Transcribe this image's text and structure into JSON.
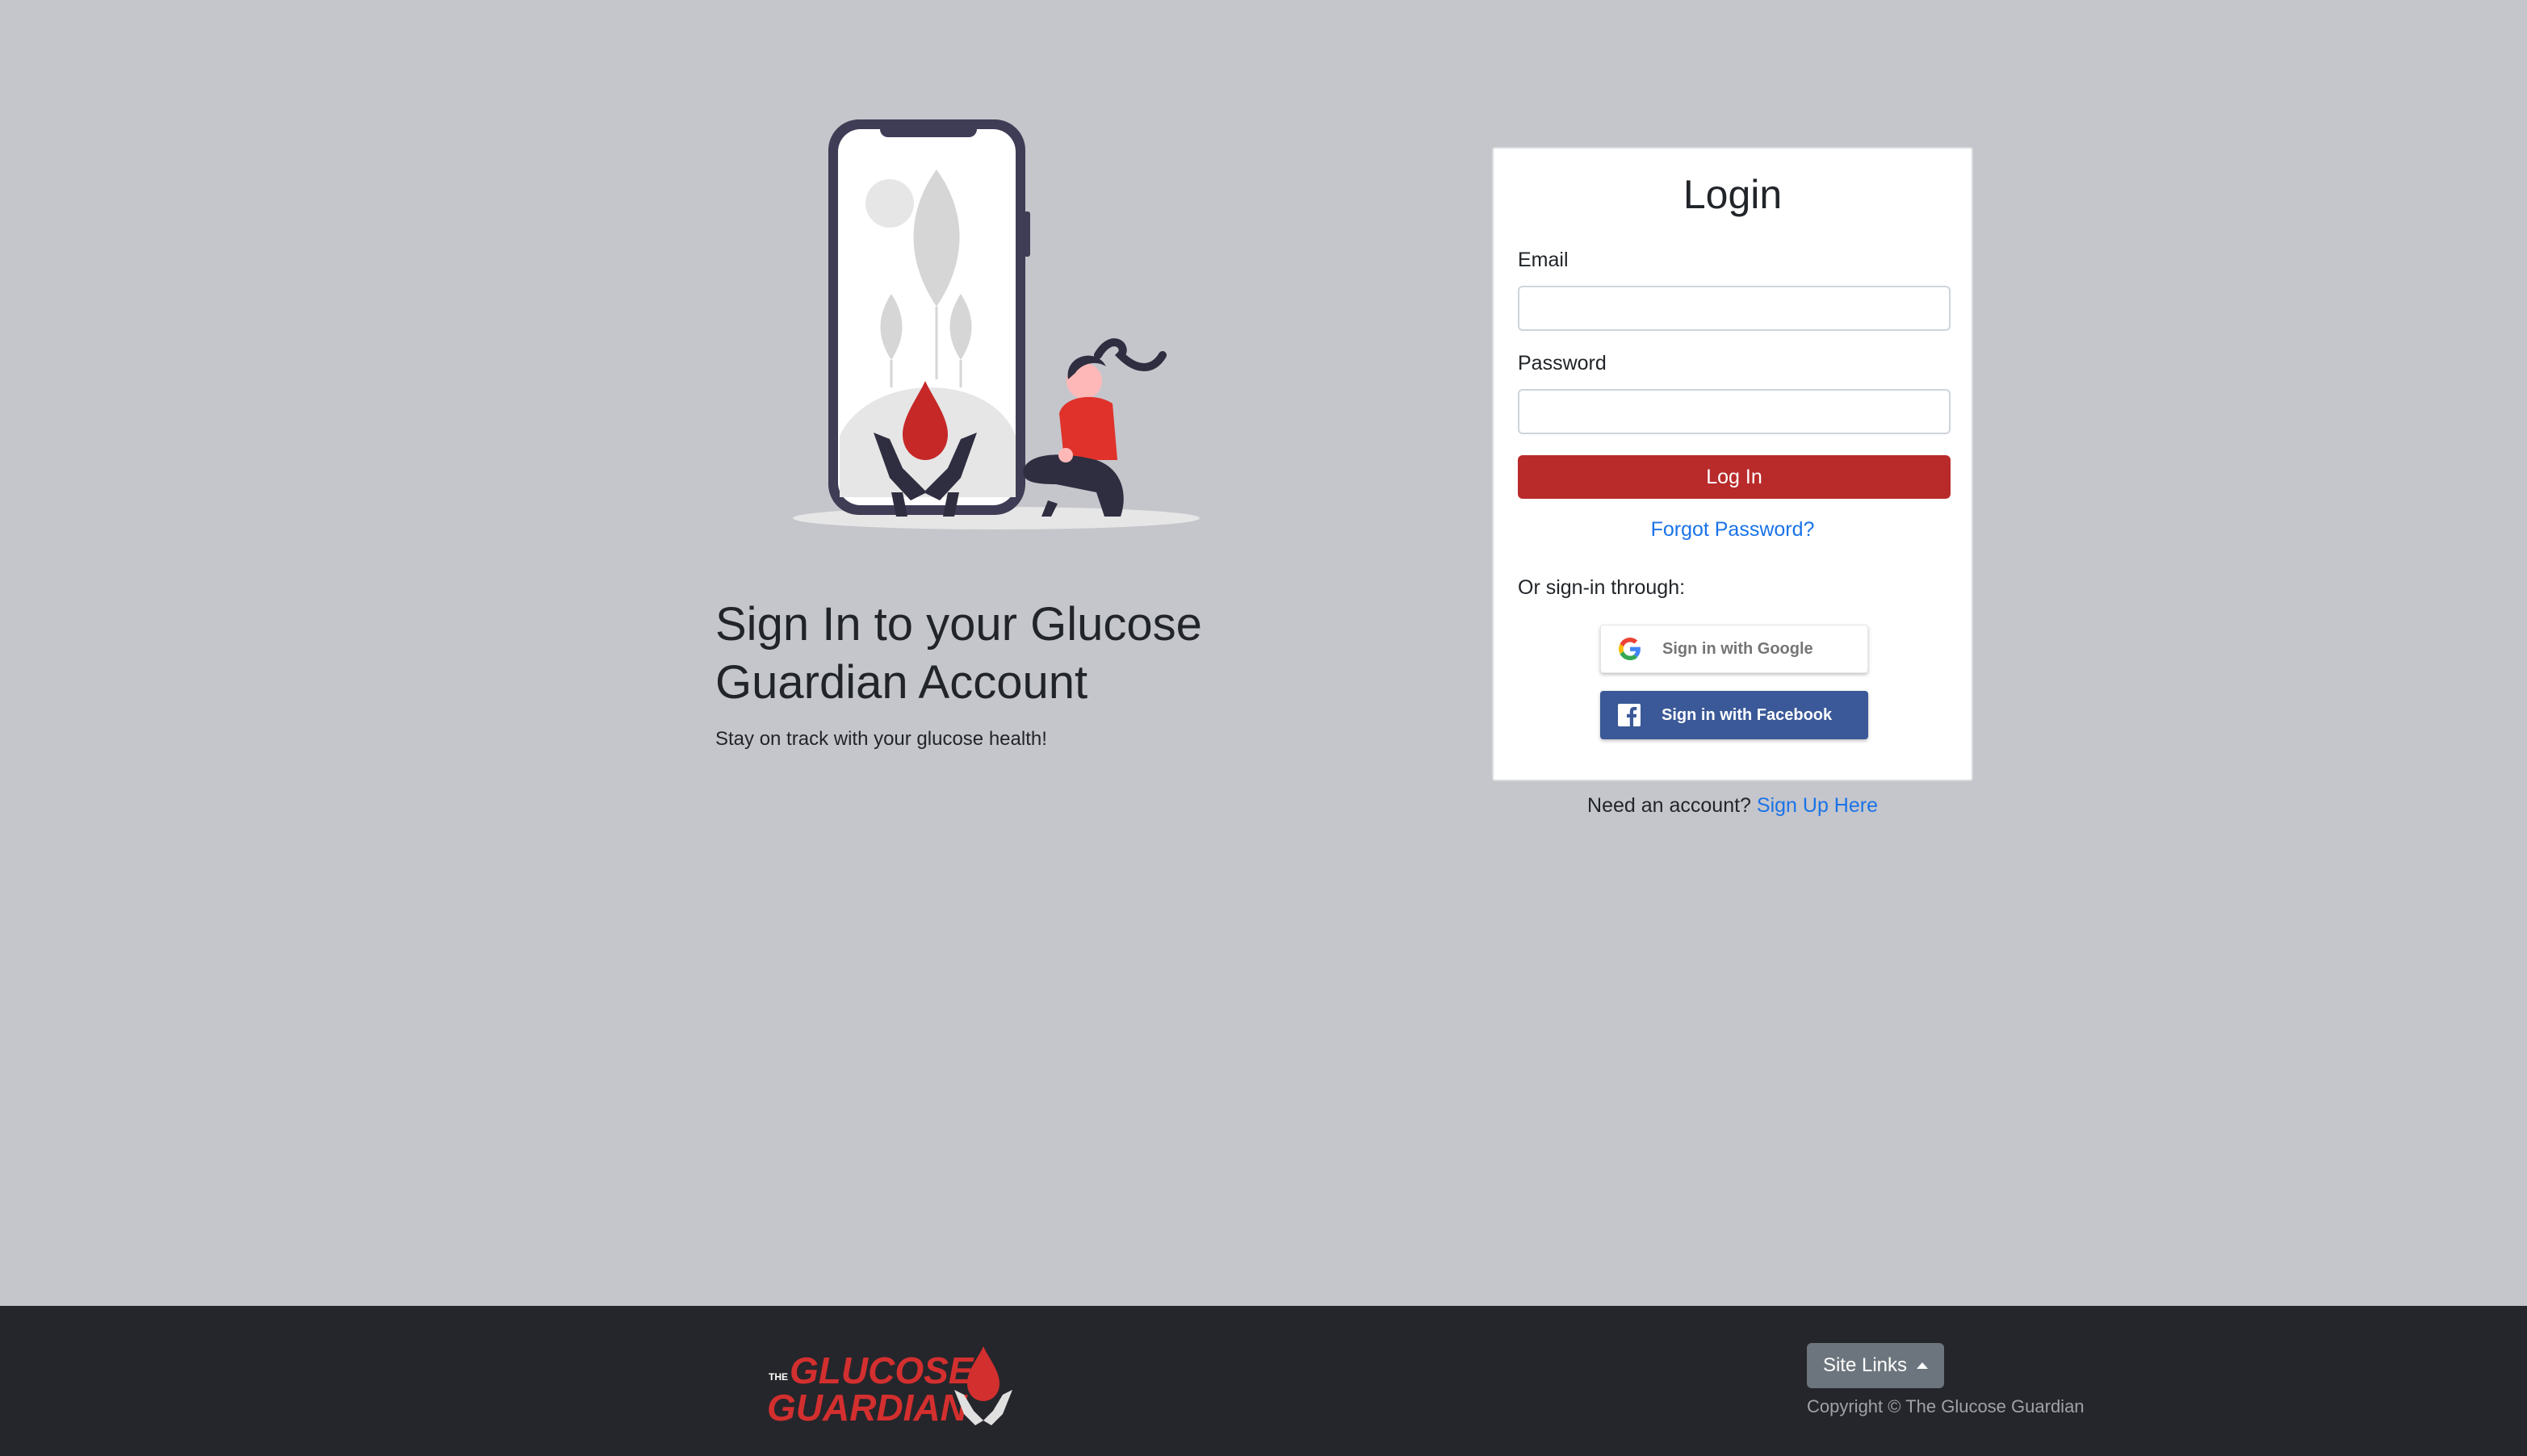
{
  "hero": {
    "heading": "Sign In to your Glucose Guardian Account",
    "subheading": "Stay on track with your glucose health!"
  },
  "login": {
    "title": "Login",
    "email_label": "Email",
    "email_value": "",
    "password_label": "Password",
    "password_value": "",
    "login_button": "Log In",
    "forgot_link": "Forgot Password?",
    "or_text": "Or sign-in through:",
    "google_button": "Sign in with Google",
    "facebook_button": "Sign in with Facebook"
  },
  "signup": {
    "prompt": "Need an account?",
    "link": "Sign Up Here"
  },
  "footer": {
    "logo_small": "THE",
    "logo_line1": "GLUCOSE",
    "logo_line2": "GUARDIAN",
    "site_links": "Site Links",
    "copyright": "Copyright © The Glucose Guardian"
  },
  "colors": {
    "background": "#c5c6cb",
    "brand_red": "#b92b2b",
    "link_blue": "#1a73e8",
    "facebook_blue": "#3b5998",
    "footer_bg": "#25262b"
  },
  "icons": [
    "phone-illustration",
    "blood-drop-icon",
    "caring-hands-icon",
    "google-icon",
    "facebook-icon",
    "caret-up-icon"
  ]
}
